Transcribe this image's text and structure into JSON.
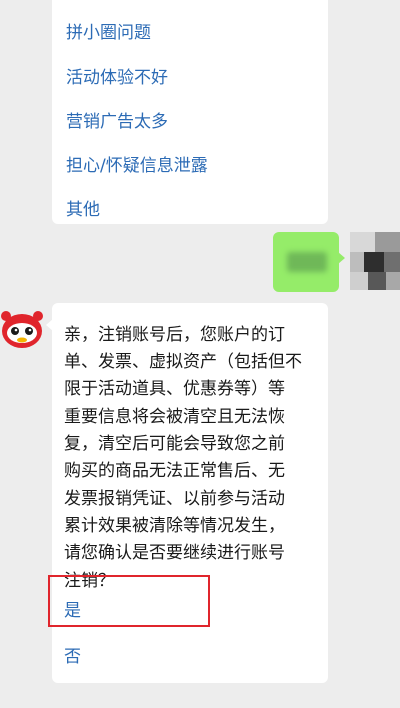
{
  "options_bubble": {
    "items": [
      {
        "label": "拼小圈问题"
      },
      {
        "label": "活动体验不好"
      },
      {
        "label": "营销广告太多"
      },
      {
        "label": "担心/怀疑信息泄露"
      },
      {
        "label": "其他"
      }
    ]
  },
  "bot_message": {
    "lines": [
      "亲，注销账号后，您账户的订",
      "单、发票、虚拟资产（包括但不",
      "限于活动道具、优惠券等）等",
      "重要信息将会被清空且无法恢",
      "复，清空后可能会导致您之前",
      "购买的商品无法正常售后、无",
      "发票报销凭证、以前参与活动",
      "累计效果被清除等情况发生，",
      "请您确认是否要继续进行账号",
      "注销？"
    ],
    "answers": {
      "yes": "是",
      "no": "否"
    }
  },
  "colors": {
    "link": "#2c6bb5",
    "outgoing_bubble": "#95ec69",
    "highlight": "#e0252c",
    "background": "#ededed"
  },
  "icons": {
    "bot_avatar": "red-mascot-avatar-icon",
    "user_avatar": "pixelated-avatar-icon"
  }
}
